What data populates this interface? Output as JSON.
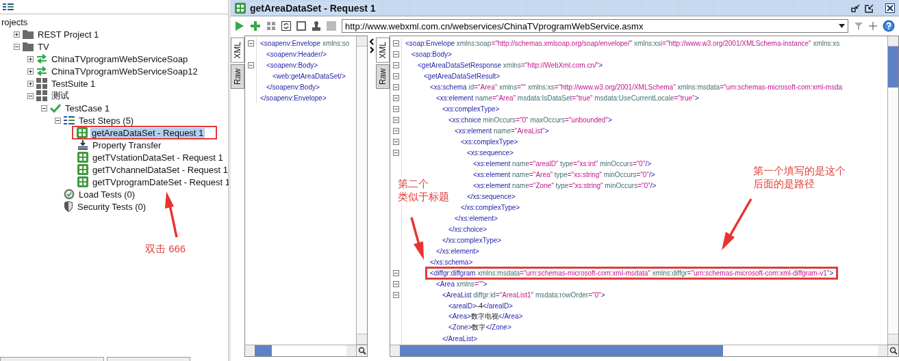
{
  "navigator": {
    "tree": [
      {
        "label": "rojects",
        "selected": false,
        "highlighted": false,
        "children": [
          {
            "label": "REST Project 1",
            "kind": "folder",
            "expanded": false,
            "selected": false,
            "highlighted": false
          },
          {
            "label": "TV",
            "kind": "folder",
            "expanded": true,
            "selected": false,
            "highlighted": false,
            "children": [
              {
                "label": "ChinaTVprogramWebServiceSoap",
                "kind": "interface",
                "expanded": false,
                "selected": false,
                "highlighted": false
              },
              {
                "label": "ChinaTVprogramWebServiceSoap12",
                "kind": "interface",
                "expanded": false,
                "selected": false,
                "highlighted": false
              },
              {
                "label": "TestSuite 1",
                "kind": "suite",
                "expanded": false,
                "selected": false,
                "highlighted": false
              },
              {
                "label": "测试",
                "kind": "suite",
                "expanded": true,
                "selected": false,
                "highlighted": false,
                "children": [
                  {
                    "label": "TestCase 1",
                    "kind": "testcase",
                    "expanded": true,
                    "selected": false,
                    "highlighted": false,
                    "children": [
                      {
                        "label": "Test Steps (5)",
                        "kind": "steps",
                        "expanded": true,
                        "selected": false,
                        "highlighted": false,
                        "children": [
                          {
                            "label": "getAreaDataSet - Request 1",
                            "kind": "soap",
                            "selected": true,
                            "highlighted": true
                          },
                          {
                            "label": "Property Transfer",
                            "kind": "transfer",
                            "selected": false,
                            "highlighted": false
                          },
                          {
                            "label": "getTVstationDataSet - Request 1",
                            "kind": "soap",
                            "selected": false,
                            "highlighted": false
                          },
                          {
                            "label": "getTVchannelDataSet - Request 1",
                            "kind": "soap",
                            "selected": false,
                            "highlighted": false
                          },
                          {
                            "label": "getTVprogramDateSet - Request 1",
                            "kind": "soap",
                            "selected": false,
                            "highlighted": false
                          }
                        ]
                      },
                      {
                        "label": "Load Tests (0)",
                        "kind": "load",
                        "selected": false,
                        "highlighted": false
                      },
                      {
                        "label": "Security Tests (0)",
                        "kind": "security",
                        "selected": false,
                        "highlighted": false
                      }
                    ]
                  }
                ]
              }
            ]
          }
        ]
      }
    ]
  },
  "editor": {
    "title": "getAreaDataSet - Request 1",
    "endpoint": "http://www.webxml.com.cn/webservices/ChinaTVprogramWebService.asmx",
    "request": {
      "tabs": [
        {
          "label": "XML",
          "selected": true
        },
        {
          "label": "Raw",
          "selected": false
        }
      ],
      "xml": [
        {
          "fold": true,
          "highlighted": false,
          "segments": [
            {
              "kind": "tag",
              "text": "<soapenv:Envelope"
            },
            {
              "kind": "attr",
              "text": " xmlns:so"
            }
          ],
          "children": [
            {
              "fold": false,
              "highlighted": false,
              "segments": [
                {
                  "kind": "tag",
                  "text": "<soapenv:Header/>"
                }
              ]
            },
            {
              "fold": true,
              "highlighted": false,
              "segments": [
                {
                  "kind": "tag",
                  "text": "<soapenv:Body>"
                }
              ],
              "children": [
                {
                  "fold": false,
                  "highlighted": false,
                  "segments": [
                    {
                      "kind": "tag",
                      "text": "<web:getAreaDataSet/>"
                    }
                  ]
                }
              ]
            },
            {
              "fold": false,
              "highlighted": false,
              "segments": [
                {
                  "kind": "tag",
                  "text": "</soapenv:Body>"
                }
              ]
            }
          ]
        },
        {
          "fold": false,
          "highlighted": false,
          "segments": [
            {
              "kind": "tag",
              "text": "</soapenv:Envelope>"
            }
          ]
        }
      ]
    },
    "response": {
      "tabs": [
        {
          "label": "XML",
          "selected": true
        },
        {
          "label": "Raw",
          "selected": false
        }
      ],
      "xml": [
        {
          "fold": true,
          "highlighted": false,
          "segments": [
            {
              "kind": "tag",
              "text": "<soap:Envelope"
            },
            {
              "kind": "attr",
              "text": " xmlns:soap"
            },
            {
              "kind": "value",
              "text": "=\"http://schemas.xmlsoap.org/soap/envelope/\""
            },
            {
              "kind": "attr",
              "text": " xmlns:xsi"
            },
            {
              "kind": "value",
              "text": "=\"http://www.w3.org/2001/XMLSchema-instance\""
            },
            {
              "kind": "attr",
              "text": " xmlns:xs"
            }
          ],
          "children": [
            {
              "fold": true,
              "highlighted": false,
              "segments": [
                {
                  "kind": "tag",
                  "text": "<soap:Body>"
                }
              ],
              "children": [
                {
                  "fold": true,
                  "highlighted": false,
                  "segments": [
                    {
                      "kind": "tag",
                      "text": "<getAreaDataSetResponse"
                    },
                    {
                      "kind": "attr",
                      "text": " xmlns"
                    },
                    {
                      "kind": "value",
                      "text": "=\"http://WebXml.com.cn/\""
                    },
                    {
                      "kind": "tag",
                      "text": ">"
                    }
                  ],
                  "children": [
                    {
                      "fold": true,
                      "highlighted": false,
                      "segments": [
                        {
                          "kind": "tag",
                          "text": "<getAreaDataSetResult>"
                        }
                      ],
                      "children": [
                        {
                          "fold": true,
                          "highlighted": false,
                          "segments": [
                            {
                              "kind": "tag",
                              "text": "<xs:schema"
                            },
                            {
                              "kind": "attr",
                              "text": " id"
                            },
                            {
                              "kind": "value",
                              "text": "=\"Area\""
                            },
                            {
                              "kind": "attr",
                              "text": " xmlns"
                            },
                            {
                              "kind": "value",
                              "text": "=\"\""
                            },
                            {
                              "kind": "attr",
                              "text": " xmlns:xs"
                            },
                            {
                              "kind": "value",
                              "text": "=\"http://www.w3.org/2001/XMLSchema\""
                            },
                            {
                              "kind": "attr",
                              "text": " xmlns:msdata"
                            },
                            {
                              "kind": "value",
                              "text": "=\"urn:schemas-microsoft-com:xml-msda"
                            }
                          ],
                          "children": [
                            {
                              "fold": true,
                              "highlighted": false,
                              "segments": [
                                {
                                  "kind": "tag",
                                  "text": "<xs:element"
                                },
                                {
                                  "kind": "attr",
                                  "text": " name"
                                },
                                {
                                  "kind": "value",
                                  "text": "=\"Area\""
                                },
                                {
                                  "kind": "attr",
                                  "text": " msdata:IsDataSet"
                                },
                                {
                                  "kind": "value",
                                  "text": "=\"true\""
                                },
                                {
                                  "kind": "attr",
                                  "text": " msdata:UseCurrentLocale"
                                },
                                {
                                  "kind": "value",
                                  "text": "=\"true\""
                                },
                                {
                                  "kind": "tag",
                                  "text": ">"
                                }
                              ],
                              "children": [
                                {
                                  "fold": true,
                                  "highlighted": false,
                                  "segments": [
                                    {
                                      "kind": "tag",
                                      "text": "<xs:complexType>"
                                    }
                                  ],
                                  "children": [
                                    {
                                      "fold": true,
                                      "highlighted": false,
                                      "segments": [
                                        {
                                          "kind": "tag",
                                          "text": "<xs:choice"
                                        },
                                        {
                                          "kind": "attr",
                                          "text": " minOccurs"
                                        },
                                        {
                                          "kind": "value",
                                          "text": "=\"0\""
                                        },
                                        {
                                          "kind": "attr",
                                          "text": " maxOccurs"
                                        },
                                        {
                                          "kind": "value",
                                          "text": "=\"unbounded\""
                                        },
                                        {
                                          "kind": "tag",
                                          "text": ">"
                                        }
                                      ],
                                      "children": [
                                        {
                                          "fold": true,
                                          "highlighted": false,
                                          "segments": [
                                            {
                                              "kind": "tag",
                                              "text": "<xs:element"
                                            },
                                            {
                                              "kind": "attr",
                                              "text": " name"
                                            },
                                            {
                                              "kind": "value",
                                              "text": "=\"AreaList\""
                                            },
                                            {
                                              "kind": "tag",
                                              "text": ">"
                                            }
                                          ],
                                          "children": [
                                            {
                                              "fold": true,
                                              "highlighted": false,
                                              "segments": [
                                                {
                                                  "kind": "tag",
                                                  "text": "<xs:complexType>"
                                                }
                                              ],
                                              "children": [
                                                {
                                                  "fold": true,
                                                  "highlighted": false,
                                                  "segments": [
                                                    {
                                                      "kind": "tag",
                                                      "text": "<xs:sequence>"
                                                    }
                                                  ],
                                                  "children": [
                                                    {
                                                      "fold": false,
                                                      "highlighted": false,
                                                      "segments": [
                                                        {
                                                          "kind": "tag",
                                                          "text": "<xs:element"
                                                        },
                                                        {
                                                          "kind": "attr",
                                                          "text": " name"
                                                        },
                                                        {
                                                          "kind": "value",
                                                          "text": "=\"arealD\""
                                                        },
                                                        {
                                                          "kind": "attr",
                                                          "text": " type"
                                                        },
                                                        {
                                                          "kind": "value",
                                                          "text": "=\"xs:int\""
                                                        },
                                                        {
                                                          "kind": "attr",
                                                          "text": " minOccurs"
                                                        },
                                                        {
                                                          "kind": "value",
                                                          "text": "=\"0\""
                                                        },
                                                        {
                                                          "kind": "tag",
                                                          "text": "/>"
                                                        }
                                                      ]
                                                    },
                                                    {
                                                      "fold": false,
                                                      "highlighted": false,
                                                      "segments": [
                                                        {
                                                          "kind": "tag",
                                                          "text": "<xs:element"
                                                        },
                                                        {
                                                          "kind": "attr",
                                                          "text": " name"
                                                        },
                                                        {
                                                          "kind": "value",
                                                          "text": "=\"Area\""
                                                        },
                                                        {
                                                          "kind": "attr",
                                                          "text": " type"
                                                        },
                                                        {
                                                          "kind": "value",
                                                          "text": "=\"xs:string\""
                                                        },
                                                        {
                                                          "kind": "attr",
                                                          "text": " minOccurs"
                                                        },
                                                        {
                                                          "kind": "value",
                                                          "text": "=\"0\""
                                                        },
                                                        {
                                                          "kind": "tag",
                                                          "text": "/>"
                                                        }
                                                      ]
                                                    },
                                                    {
                                                      "fold": false,
                                                      "highlighted": false,
                                                      "segments": [
                                                        {
                                                          "kind": "tag",
                                                          "text": "<xs:element"
                                                        },
                                                        {
                                                          "kind": "attr",
                                                          "text": " name"
                                                        },
                                                        {
                                                          "kind": "value",
                                                          "text": "=\"Zone\""
                                                        },
                                                        {
                                                          "kind": "attr",
                                                          "text": " type"
                                                        },
                                                        {
                                                          "kind": "value",
                                                          "text": "=\"xs:string\""
                                                        },
                                                        {
                                                          "kind": "attr",
                                                          "text": " minOccurs"
                                                        },
                                                        {
                                                          "kind": "value",
                                                          "text": "=\"0\""
                                                        },
                                                        {
                                                          "kind": "tag",
                                                          "text": "/>"
                                                        }
                                                      ]
                                                    }
                                                  ]
                                                },
                                                {
                                                  "fold": false,
                                                  "highlighted": false,
                                                  "segments": [
                                                    {
                                                      "kind": "tag",
                                                      "text": "</xs:sequence>"
                                                    }
                                                  ]
                                                }
                                              ]
                                            },
                                            {
                                              "fold": false,
                                              "highlighted": false,
                                              "segments": [
                                                {
                                                  "kind": "tag",
                                                  "text": "</xs:complexType>"
                                                }
                                              ]
                                            }
                                          ]
                                        },
                                        {
                                          "fold": false,
                                          "highlighted": false,
                                          "segments": [
                                            {
                                              "kind": "tag",
                                              "text": "</xs:element>"
                                            }
                                          ]
                                        }
                                      ]
                                    },
                                    {
                                      "fold": false,
                                      "highlighted": false,
                                      "segments": [
                                        {
                                          "kind": "tag",
                                          "text": "</xs:choice>"
                                        }
                                      ]
                                    }
                                  ]
                                },
                                {
                                  "fold": false,
                                  "highlighted": false,
                                  "segments": [
                                    {
                                      "kind": "tag",
                                      "text": "</xs:complexType>"
                                    }
                                  ]
                                }
                              ]
                            },
                            {
                              "fold": false,
                              "highlighted": false,
                              "segments": [
                                {
                                  "kind": "tag",
                                  "text": "</xs:element>"
                                }
                              ]
                            }
                          ]
                        },
                        {
                          "fold": false,
                          "highlighted": false,
                          "segments": [
                            {
                              "kind": "tag",
                              "text": "</xs:schema>"
                            }
                          ]
                        },
                        {
                          "fold": true,
                          "highlighted": true,
                          "segments": [
                            {
                              "kind": "tag",
                              "text": "<diffgr:diffgram"
                            },
                            {
                              "kind": "attr",
                              "text": " xmlns:msdata"
                            },
                            {
                              "kind": "value",
                              "text": "=\"urn:schemas-microsoft-com:xml-msdata\""
                            },
                            {
                              "kind": "attr",
                              "text": " xmlns:diffgr"
                            },
                            {
                              "kind": "value",
                              "text": "=\"urn:schemas-microsoft-com:xml-diffgram-v1\""
                            },
                            {
                              "kind": "tag",
                              "text": ">"
                            }
                          ],
                          "children": [
                            {
                              "fold": true,
                              "highlighted": false,
                              "segments": [
                                {
                                  "kind": "tag",
                                  "text": "<Area"
                                },
                                {
                                  "kind": "attr",
                                  "text": " xmlns"
                                },
                                {
                                  "kind": "value",
                                  "text": "=\"\""
                                },
                                {
                                  "kind": "tag",
                                  "text": ">"
                                }
                              ],
                              "children": [
                                {
                                  "fold": true,
                                  "highlighted": false,
                                  "segments": [
                                    {
                                      "kind": "tag",
                                      "text": "<AreaList"
                                    },
                                    {
                                      "kind": "attr",
                                      "text": " diffgr:id"
                                    },
                                    {
                                      "kind": "value",
                                      "text": "=\"AreaList1\""
                                    },
                                    {
                                      "kind": "attr",
                                      "text": " msdata:rowOrder"
                                    },
                                    {
                                      "kind": "value",
                                      "text": "=\"0\""
                                    },
                                    {
                                      "kind": "tag",
                                      "text": ">"
                                    }
                                  ],
                                  "children": [
                                    {
                                      "fold": false,
                                      "highlighted": false,
                                      "segments": [
                                        {
                                          "kind": "tag",
                                          "text": "<arealD>"
                                        },
                                        {
                                          "kind": "text",
                                          "text": "-4"
                                        },
                                        {
                                          "kind": "tag",
                                          "text": "</arealD>"
                                        }
                                      ]
                                    },
                                    {
                                      "fold": false,
                                      "highlighted": false,
                                      "segments": [
                                        {
                                          "kind": "tag",
                                          "text": "<Area>"
                                        },
                                        {
                                          "kind": "text",
                                          "text": "数字电视"
                                        },
                                        {
                                          "kind": "tag",
                                          "text": "</Area>"
                                        }
                                      ]
                                    },
                                    {
                                      "fold": false,
                                      "highlighted": false,
                                      "segments": [
                                        {
                                          "kind": "tag",
                                          "text": "<Zone>"
                                        },
                                        {
                                          "kind": "text",
                                          "text": "数字"
                                        },
                                        {
                                          "kind": "tag",
                                          "text": "</Zone>"
                                        }
                                      ]
                                    }
                                  ]
                                },
                                {
                                  "fold": false,
                                  "highlighted": false,
                                  "segments": [
                                    {
                                      "kind": "tag",
                                      "text": "</AreaList>"
                                    }
                                  ]
                                }
                              ]
                            }
                          ]
                        }
                      ]
                    }
                  ]
                }
              ]
            }
          ]
        }
      ]
    }
  },
  "annotations": [
    {
      "lines": [
        "双击 666"
      ]
    },
    {
      "lines": [
        "第二个",
        "类似于标题"
      ]
    },
    {
      "lines": [
        "第一个填写的是这个",
        "后面的是路径"
      ]
    }
  ]
}
